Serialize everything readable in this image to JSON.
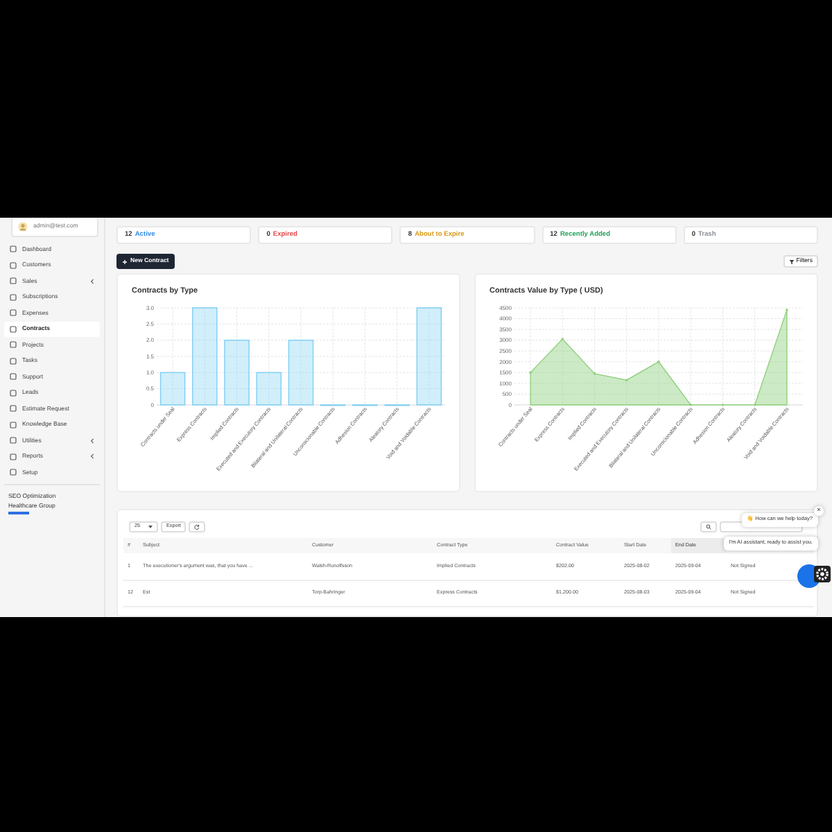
{
  "user": {
    "email": "admin@test.com"
  },
  "sidebar": {
    "items": [
      {
        "label": "Dashboard",
        "selected": false,
        "has_submenu": false
      },
      {
        "label": "Customers",
        "selected": false,
        "has_submenu": false
      },
      {
        "label": "Sales",
        "selected": false,
        "has_submenu": true
      },
      {
        "label": "Subscriptions",
        "selected": false,
        "has_submenu": false
      },
      {
        "label": "Expenses",
        "selected": false,
        "has_submenu": false
      },
      {
        "label": "Contracts",
        "selected": true,
        "has_submenu": false
      },
      {
        "label": "Projects",
        "selected": false,
        "has_submenu": false
      },
      {
        "label": "Tasks",
        "selected": false,
        "has_submenu": false
      },
      {
        "label": "Support",
        "selected": false,
        "has_submenu": false
      },
      {
        "label": "Leads",
        "selected": false,
        "has_submenu": false
      },
      {
        "label": "Estimate Request",
        "selected": false,
        "has_submenu": false
      },
      {
        "label": "Knowledge Base",
        "selected": false,
        "has_submenu": false
      },
      {
        "label": "Utilities",
        "selected": false,
        "has_submenu": true
      },
      {
        "label": "Reports",
        "selected": false,
        "has_submenu": true
      },
      {
        "label": "Setup",
        "selected": false,
        "has_submenu": false
      }
    ],
    "footer": {
      "title": "SEO Optimization",
      "subtitle": "Healthcare Group"
    }
  },
  "stats": [
    {
      "count": "12",
      "label": "Active",
      "color": "#2f8be6"
    },
    {
      "count": "0",
      "label": "Expired",
      "color": "#e5484d"
    },
    {
      "count": "8",
      "label": "About to Expire",
      "color": "#d99a18"
    },
    {
      "count": "12",
      "label": "Recently Added",
      "color": "#22a35a"
    },
    {
      "count": "0",
      "label": "Trash",
      "color": "#8a8f98"
    }
  ],
  "toolbar": {
    "new_button": "New Contract",
    "filters_button": "Filters"
  },
  "charts": [
    {
      "chart_data": {
        "type": "bar",
        "title": "Contracts by Type",
        "grid": true,
        "categories": [
          "Contracts under Seal",
          "Express Contracts",
          "Implied Contracts",
          "Executed and Executory Contracts",
          "Bilateral and Unilateral Contracts",
          "Unconscionable Contracts",
          "Adhesion Contracts",
          "Aleatory Contracts",
          "Void and Voidable Contracts"
        ],
        "ylim": [
          0,
          3
        ],
        "yticks": [
          {
            "value": 0,
            "label": "0"
          },
          {
            "value": 0.5,
            "label": "0.5"
          },
          {
            "value": 1,
            "label": "1.0"
          },
          {
            "value": 1.5,
            "label": "1.5"
          },
          {
            "value": 2,
            "label": "2.0"
          },
          {
            "value": 2.5,
            "label": "2.5"
          },
          {
            "value": 3,
            "label": "3.0"
          }
        ],
        "series": [
          {
            "color": "#7ccff3",
            "values": [
              1,
              3,
              2,
              1,
              2,
              0,
              0,
              0,
              3
            ]
          }
        ]
      }
    },
    {
      "chart_data": {
        "type": "area",
        "title": "Contracts Value by Type ( USD)",
        "grid": true,
        "categories": [
          "Contracts under Seal",
          "Express Contracts",
          "Implied Contracts",
          "Executed and Executory Contracts",
          "Bilateral and Unilateral Contracts",
          "Unconscionable Contracts",
          "Adhesion Contracts",
          "Aleatory Contracts",
          "Void and Voidable Contracts"
        ],
        "ylim": [
          0,
          4500
        ],
        "yticks": [
          0,
          500,
          1000,
          1500,
          2000,
          2500,
          3000,
          3500,
          4000,
          4500
        ],
        "series": [
          {
            "color": "#8fd17e",
            "values": [
              1500,
              3050,
              1450,
              1150,
              2000,
              0,
              0,
              0,
              4400
            ]
          }
        ]
      }
    }
  ],
  "table": {
    "page_size": "25",
    "export_button": "Export",
    "columns": [
      {
        "label": "#",
        "sorted": false
      },
      {
        "label": "Subject",
        "sorted": false
      },
      {
        "label": "Customer",
        "sorted": false
      },
      {
        "label": "Contract Type",
        "sorted": false
      },
      {
        "label": "Contract Value",
        "sorted": false
      },
      {
        "label": "Start Date",
        "sorted": false
      },
      {
        "label": "End Date",
        "sorted": true
      }
    ],
    "rows": [
      [
        "1",
        "The executioner's argument was, that you have ...",
        "Walsh-Runolfsson",
        "Implied Contracts",
        "$202.00",
        "2025-08-02",
        "2025-09-04",
        "Not Signed"
      ],
      [
        "12",
        "Est",
        "Torp-Bahringer",
        "Express Contracts",
        "$1,200.00",
        "2025-08-03",
        "2025-09-04",
        "Not Signed"
      ]
    ]
  },
  "chat": {
    "greeting": "👋 How can we help today?",
    "close": "×",
    "message": "I'm AI assistant, ready to assist you."
  }
}
